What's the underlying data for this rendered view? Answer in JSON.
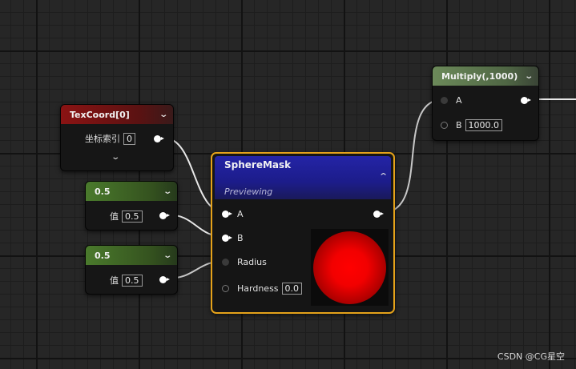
{
  "nodes": {
    "texcoord": {
      "title": "TexCoord[0]",
      "param_label": "坐标索引",
      "param_value": "0"
    },
    "const1": {
      "title": "0.5",
      "param_label": "值",
      "param_value": "0.5"
    },
    "const2": {
      "title": "0.5",
      "param_label": "值",
      "param_value": "0.5"
    },
    "spheremask": {
      "title": "SphereMask",
      "subtitle": "Previewing",
      "pins": {
        "a": "A",
        "b": "B",
        "radius": "Radius",
        "hardness": "Hardness"
      },
      "hardness_value": "0.0"
    },
    "multiply": {
      "title": "Multiply(,1000)",
      "pins": {
        "a": "A",
        "b": "B"
      },
      "b_value": "1000.0"
    }
  },
  "watermark": "CSDN @CG星空",
  "colors": {
    "texcoord_header": "#8b1313",
    "constant_header": "#4a7a2c",
    "spheremask_header": "#2a2aa8",
    "multiply_header": "#6c8a5a",
    "selection_border": "#e5a21a",
    "preview_sphere": "#ff0000"
  }
}
